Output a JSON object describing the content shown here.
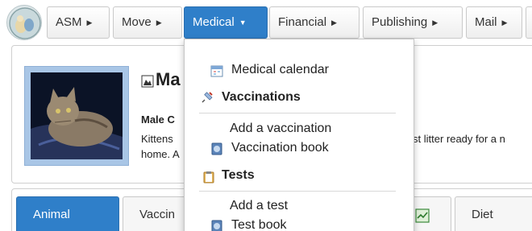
{
  "menubar": {
    "items": [
      {
        "label": "ASM"
      },
      {
        "label": "Move"
      },
      {
        "label": "Medical"
      },
      {
        "label": "Financial"
      },
      {
        "label": "Publishing"
      },
      {
        "label": "Mail"
      }
    ],
    "active": "Medical",
    "accent": "#2f7fc9"
  },
  "animal": {
    "name": "Ma",
    "subtitle": "Male C",
    "description_line1a": "Kittens",
    "description_line1b": "st litter ready for a n",
    "description_line2": "home. A"
  },
  "tabs": [
    {
      "label": "Animal"
    },
    {
      "label": "Vaccin"
    },
    {
      "label": "Diet"
    }
  ],
  "medical_menu": {
    "calendar": "Medical calendar",
    "vaccinations_header": "Vaccinations",
    "add_vaccination": "Add a vaccination",
    "vaccination_book": "Vaccination book",
    "tests_header": "Tests",
    "add_test": "Add a test",
    "test_book": "Test book"
  }
}
